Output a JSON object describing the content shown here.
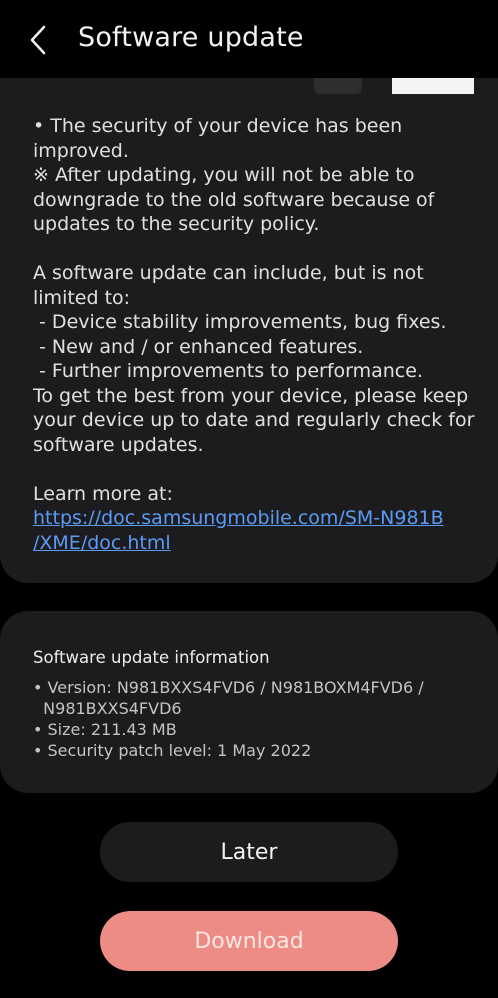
{
  "header": {
    "title": "Software update"
  },
  "notes": {
    "lines": [
      "• The security of your device has been",
      "improved.",
      "※ After updating, you will not be able to",
      "downgrade to the old software because of",
      "updates to the security policy."
    ],
    "lines2": [
      "A software update can include, but is not",
      "limited to:",
      " - Device stability improvements, bug fixes.",
      " - New and / or enhanced features.",
      " - Further improvements to performance.",
      "To get the best from your device, please keep",
      "your device up to date and regularly check for",
      "software updates."
    ],
    "learn_more": "Learn more at:",
    "link_line1": "https://doc.samsungmobile.com/SM-N981B",
    "link_line2": "/XME/doc.html"
  },
  "info": {
    "title": "Software update information",
    "version_line1": "• Version: N981BXXS4FVD6 / N981BOXM4FVD6 /",
    "version_line2": "  N981BXXS4FVD6",
    "size": "• Size: 211.43 MB",
    "security_patch": "• Security patch level: 1 May 2022"
  },
  "buttons": {
    "later": "Later",
    "download": "Download"
  },
  "colors": {
    "background": "#000000",
    "card": "#1c1c1e",
    "link": "#5a9bf5",
    "download_button": "#ec8c85"
  },
  "icons": {
    "back": "chevron-left-icon"
  }
}
